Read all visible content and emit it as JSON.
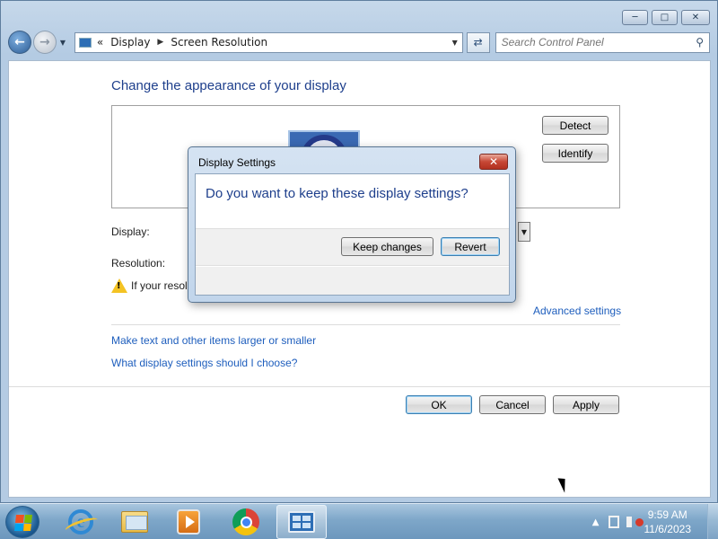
{
  "window": {
    "titlebar": {
      "minimize_icon": "minimize-icon",
      "maximize_icon": "maximize-icon",
      "close_icon": "close-icon"
    },
    "nav": {
      "back_icon": "back-arrow-icon",
      "forward_icon": "forward-arrow-icon",
      "address": {
        "overflow": "«",
        "crumbs": [
          "Display",
          "Screen Resolution"
        ]
      },
      "search_placeholder": "Search Control Panel"
    }
  },
  "content": {
    "heading": "Change the appearance of your display",
    "detect_label": "Detect",
    "identify_label": "Identify",
    "display_label": "Display:",
    "resolution_label": "Resolution:",
    "warning_text": "If your resolu",
    "advanced_settings": "Advanced settings",
    "links": [
      "Make text and other items larger or smaller",
      "What display settings should I choose?"
    ],
    "ok_label": "OK",
    "cancel_label": "Cancel",
    "apply_label": "Apply"
  },
  "dialog": {
    "title": "Display Settings",
    "message": "Do you want to keep these display settings?",
    "keep_label": "Keep changes",
    "revert_label": "Revert"
  },
  "taskbar": {
    "apps": [
      "start-orb",
      "internet-explorer",
      "windows-explorer",
      "windows-media-player",
      "google-chrome",
      "control-panel"
    ],
    "tray": {
      "up_arrow": "▲",
      "time": "9:59 AM",
      "date": "11/6/2023"
    }
  },
  "colors": {
    "heading": "#1e3f8c",
    "link": "#1e5ebd",
    "taskbar": "#7ea7c9"
  }
}
